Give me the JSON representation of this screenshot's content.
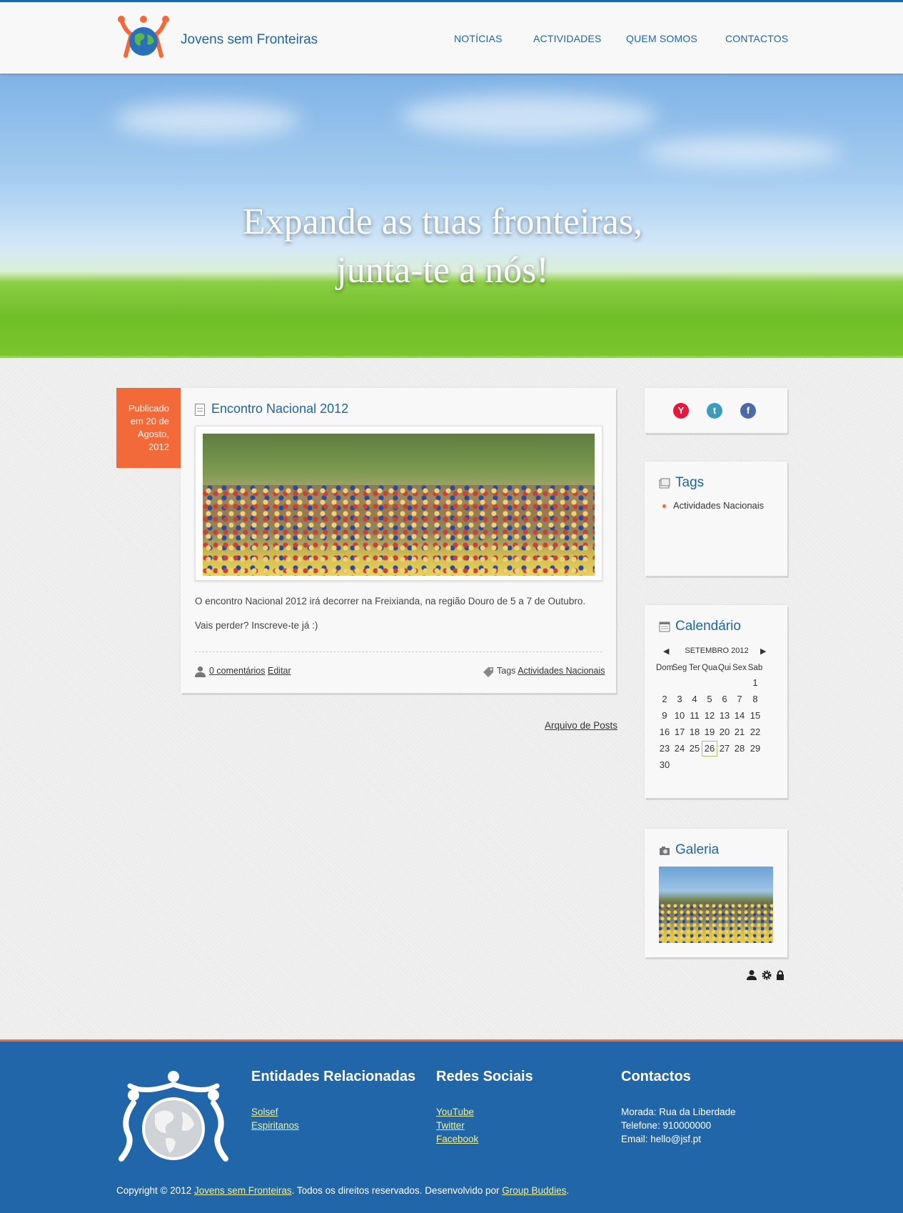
{
  "header": {
    "site_title": "Jovens sem Fronteiras",
    "nav": [
      "NOTÍCIAS",
      "ACTIVIDADES",
      "QUEM SOMOS",
      "CONTACTOS"
    ]
  },
  "hero": {
    "line1": "Expande as tuas fronteiras,",
    "line2": "junta-te a nós!"
  },
  "post": {
    "published": [
      "Publicado",
      "em 20 de",
      "Agosto,",
      "2012"
    ],
    "title": "Encontro Nacional 2012",
    "paragraph1": "O encontro Nacional 2012 irá decorrer na Freixianda, na região Douro de 5 a 7 de Outubro.",
    "paragraph2": "Vais perder? Inscreve-te já :)",
    "comments_link": "0 comentários",
    "edit_link": "Editar",
    "tags_label": "Tags",
    "tag_link": "Actividades Nacionais"
  },
  "archive_link": "Arquivo de Posts",
  "sidebar": {
    "social": [
      {
        "icon": "youtube-icon",
        "letter": "Y",
        "color": "#e8173d"
      },
      {
        "icon": "twitter-icon",
        "letter": "t",
        "color": "#3d9bbd"
      },
      {
        "icon": "facebook-icon",
        "letter": "f",
        "color": "#4a6aa5"
      }
    ],
    "tags_title": "Tags",
    "tags": [
      "Actividades Nacionais"
    ],
    "calendar_title": "Calendário",
    "calendar_month": "SETEMBRO 2012",
    "calendar_weekdays": [
      "Dom",
      "Seg",
      "Ter",
      "Qua",
      "Qui",
      "Sex",
      "Sab"
    ],
    "calendar_first_weekday": 6,
    "calendar_days_in_month": 30,
    "calendar_today": 26,
    "gallery_title": "Galeria"
  },
  "footer": {
    "entities_title": "Entidades Relacionadas",
    "entities": [
      "Solsef",
      "Espiritanos"
    ],
    "social_title": "Redes Sociais",
    "social_links": [
      "YouTube",
      "Twitter",
      "Facebook"
    ],
    "contacts_title": "Contactos",
    "address": "Morada: Rua da Liberdade",
    "phone": "Telefone: 910000000",
    "email": "Email: hello@jsf.pt",
    "copyright_prefix": "Copyright © 2012",
    "copyright_link": "Jovens sem Fronteiras",
    "copyright_middle": ". Todos os direitos reservados. Desenvolvido por",
    "developer_link": "Group Buddies",
    "copyright_suffix": "."
  },
  "colors": {
    "brand_blue": "#1f64a7",
    "accent_orange": "#f26a3a",
    "footer_blue": "#2166a8",
    "footer_link": "#eef09a"
  }
}
